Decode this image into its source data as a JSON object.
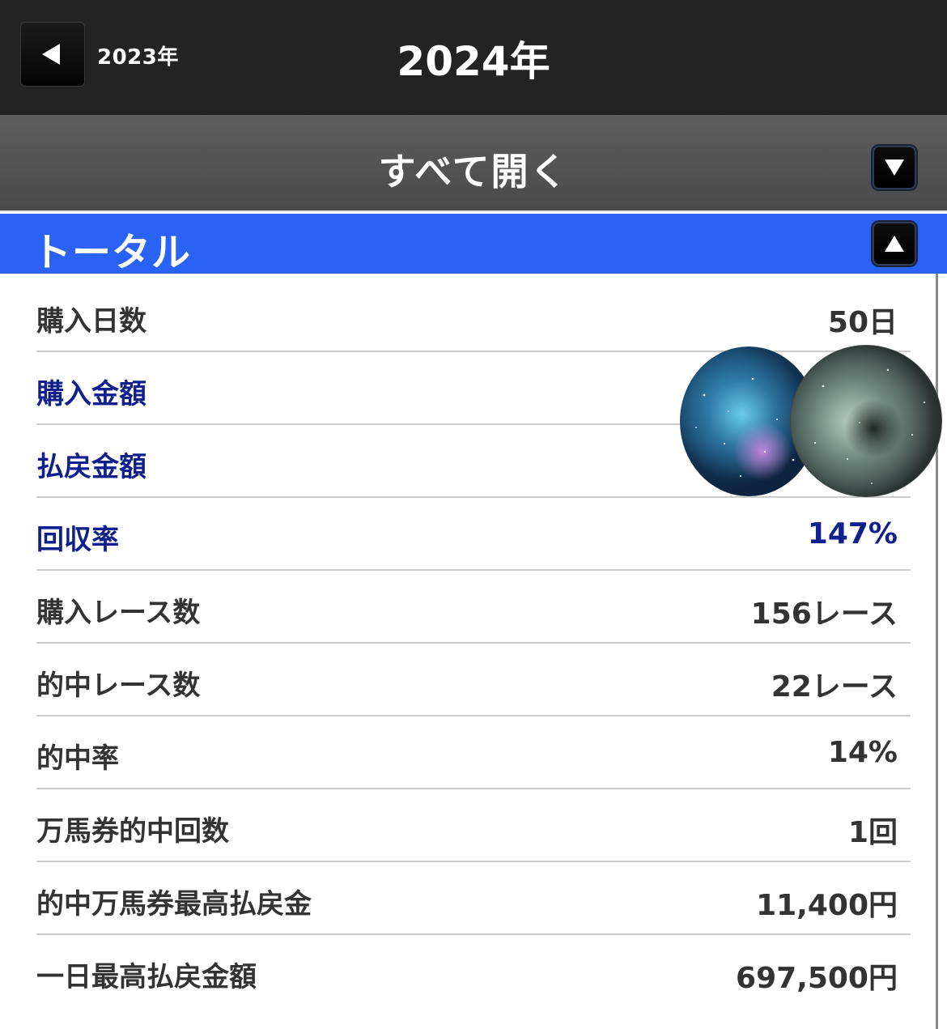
{
  "header": {
    "prev_year_label": "2023年",
    "year_title": "2024年"
  },
  "expand_all": {
    "label": "すべて開く"
  },
  "section": {
    "title": "トータル"
  },
  "rows": [
    {
      "label": "購入日数",
      "value": "50日"
    },
    {
      "label": "購入金額",
      "value": ""
    },
    {
      "label": "払戻金額",
      "value": ""
    },
    {
      "label": "回収率",
      "value": "147%"
    },
    {
      "label": "購入レース数",
      "value": "156レース"
    },
    {
      "label": "的中レース数",
      "value": "22レース"
    },
    {
      "label": "的中率",
      "value": "14%"
    },
    {
      "label": "万馬券的中回数",
      "value": "1回"
    },
    {
      "label": "的中万馬券最高払戻金",
      "value": "11,400円"
    },
    {
      "label": "一日最高払戻金額",
      "value": "697,500円"
    }
  ],
  "colors": {
    "header_bg": "#232323",
    "section_header_bg": "#2b62f6",
    "highlight_text": "#0f1f8c"
  },
  "icons": {
    "prev": "triangle-left-icon",
    "expand": "triangle-down-icon",
    "collapse": "triangle-up-icon"
  }
}
